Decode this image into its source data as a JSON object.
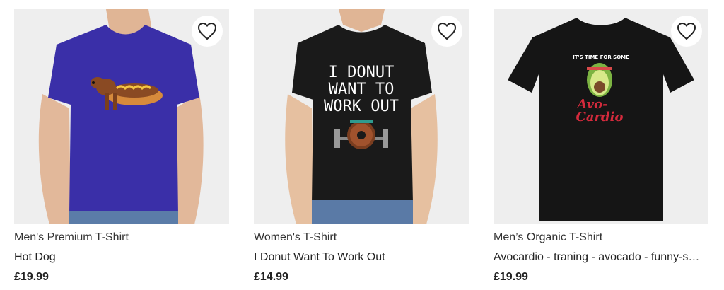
{
  "products": [
    {
      "type": "Men's Premium T-Shirt",
      "name": "Hot Dog",
      "price": "£19.99",
      "shirt_color": "#3a2fa8",
      "design": "dachshund-hotdog"
    },
    {
      "type": "Women's T-Shirt",
      "name": "I Donut Want To Work Out",
      "price": "£14.99",
      "shirt_color": "#1a1a1a",
      "design": "donut-workout",
      "design_text": [
        "I DONUT",
        "WANT TO",
        "WORK OUT"
      ]
    },
    {
      "type": "Men’s Organic T-Shirt",
      "name": "Avocardio - traning - avocado - funny-sports",
      "price": "£19.99",
      "shirt_color": "#151515",
      "design": "avocado-cardio",
      "design_text": [
        "IT'S TIME FOR SOME",
        "Avo-",
        "Cardio"
      ]
    }
  ],
  "icons": {
    "favorite": "heart-outline-icon"
  }
}
